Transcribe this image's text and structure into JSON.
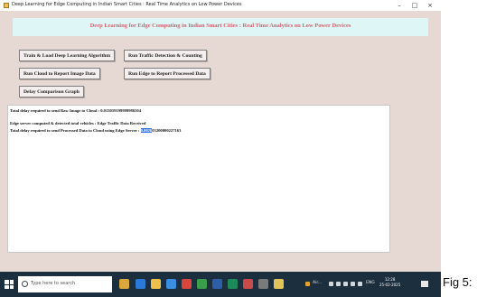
{
  "window": {
    "title": "Deep Learning for Edge Computing in Indian Smart Cities : Real Time Analytics on Low Power Devices",
    "minimize": "–",
    "maximize": "□",
    "close": "×"
  },
  "app": {
    "header_title": "Deep Learning for Edge Computing in Indian Smart Cities : Real Time Analytics on Low Power Devices",
    "buttons": {
      "train": "Train & Load Deep Learning Algorithm",
      "traffic": "Run Traffic Detection & Counting",
      "cloud": "Run Cloud to Report Image Data",
      "edge": "Run Edge to Report Processed Data",
      "delay": "Delay Comparison Graph"
    },
    "output": {
      "line1": "Total delay required to send Raw Image to Cloud : 0.013059199999986504",
      "line2": "Edge server computed & detected total vehicles : Edge Traffic Data Received",
      "line3_prefix": "Total delay required to send Processed Data to Cloud using Edge Server : ",
      "line3_selected": "0.0026",
      "line3_suffix": "03200000227163"
    }
  },
  "taskbar": {
    "search_placeholder": "Type here to search",
    "tray_app": "Air...",
    "language": "ENG",
    "time": "12:28",
    "date": "25-02-2025"
  },
  "caption": "Fig 5:",
  "colors": {
    "app_background": "#e6d8d2",
    "header_background": "#dff6f6",
    "header_text": "#d3616f",
    "selection": "#2f6ee0",
    "taskbar": "#1c2f3f"
  }
}
